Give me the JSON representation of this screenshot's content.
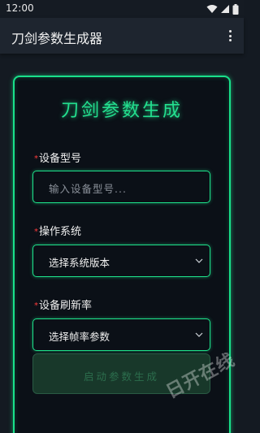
{
  "status_bar": {
    "time": "12:00"
  },
  "app_bar": {
    "title": "刀剑参数生成器"
  },
  "card": {
    "title": "刀剑参数生成"
  },
  "form": {
    "device_model": {
      "required_mark": "*",
      "label": "设备型号",
      "placeholder": "输入设备型号..."
    },
    "os": {
      "required_mark": "*",
      "label": "操作系统",
      "value": "选择系统版本"
    },
    "refresh_rate": {
      "required_mark": "*",
      "label": "设备刷新率",
      "value": "选择帧率参数"
    },
    "generate_button": {
      "label": "启动参数生成"
    }
  },
  "watermark": {
    "text": "日开在线"
  },
  "colors": {
    "accent": "#19e08a",
    "background": "#141a22",
    "required": "#ff3b3b"
  },
  "icons": [
    "wifi-icon",
    "signal-icon",
    "battery-icon",
    "overflow-menu-icon",
    "chevron-down-icon"
  ]
}
